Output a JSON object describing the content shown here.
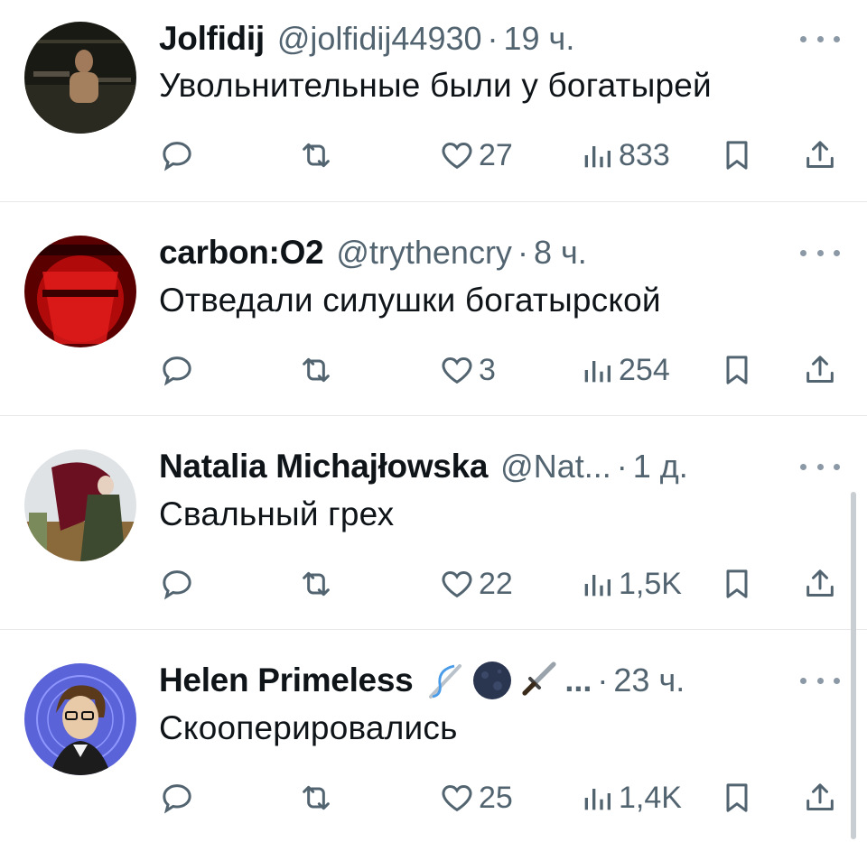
{
  "tweets": [
    {
      "name": "Jolfidij",
      "handle": "@jolfidij44930",
      "dot": "·",
      "time": "19 ч.",
      "text": "Увольнительные были у богатырей",
      "likes": "27",
      "views": "833"
    },
    {
      "name": "carbon:O2",
      "handle": "@trythencry",
      "dot": "·",
      "time": "8 ч.",
      "text": "Отведали силушки богатырской",
      "likes": "3",
      "views": "254"
    },
    {
      "name": "Natalia Michajłowska",
      "handle": "@Nat...",
      "dot": "·",
      "time": "1 д.",
      "text": "Свальный грех",
      "likes": "22",
      "views": "1,5K"
    },
    {
      "name": "Helen Primeless",
      "emojis": [
        "needle-thread-emoji",
        "new-moon-emoji",
        "dagger-emoji"
      ],
      "ellipsis": "...",
      "dot": "·",
      "time": "23 ч.",
      "text": "Скооперировались",
      "likes": "25",
      "views": "1,4K"
    }
  ],
  "colors": {
    "text": "#0f1419",
    "secondary": "#536471",
    "divider": "#e6e8ea"
  }
}
